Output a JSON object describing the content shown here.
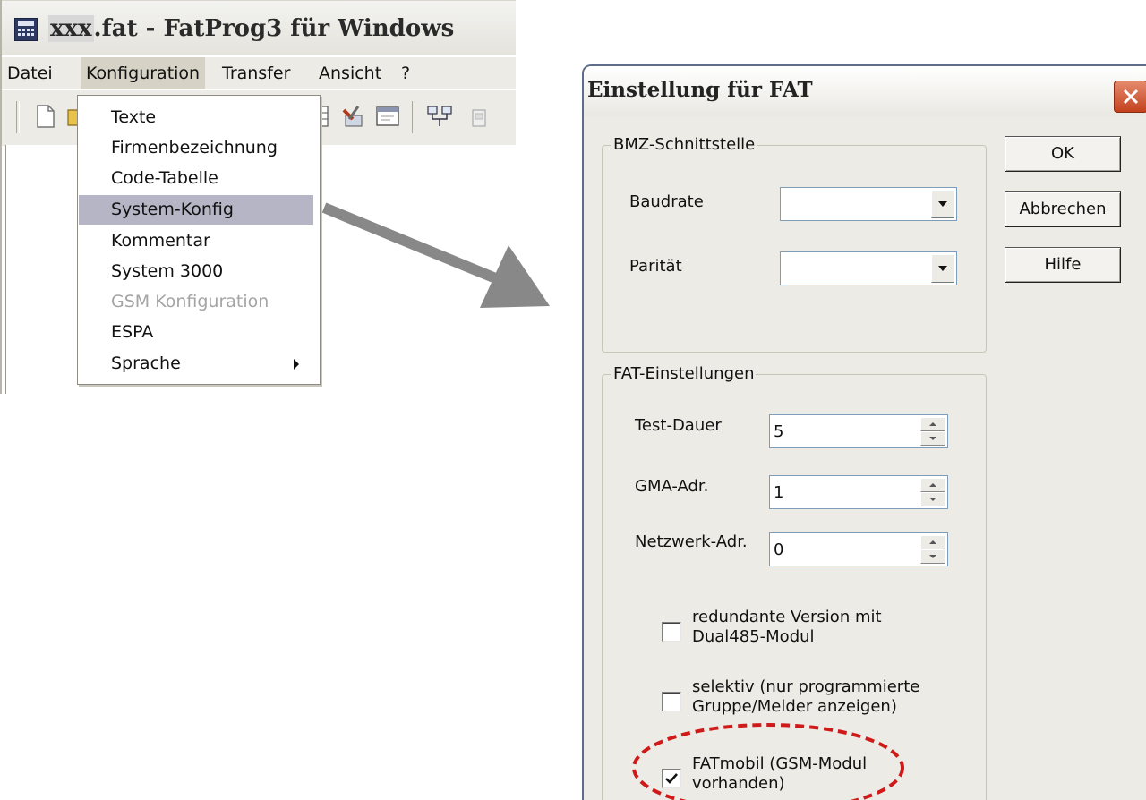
{
  "app": {
    "title_prefix": "xxx",
    "title": ".fat - FatProg3 für Windows",
    "menu": [
      "Datei",
      "Konfiguration",
      "Transfer",
      "Ansicht",
      "?"
    ],
    "open_menu": "Konfiguration"
  },
  "dropdown": {
    "items": [
      {
        "label": "Texte"
      },
      {
        "label": "Firmenbezeichnung"
      },
      {
        "label": "Code-Tabelle"
      },
      {
        "label": "System-Konfig",
        "state": "highlighted"
      },
      {
        "label": "Kommentar"
      },
      {
        "label": "System 3000"
      },
      {
        "label": "GSM Konfiguration",
        "state": "disabled"
      },
      {
        "label": "ESPA"
      },
      {
        "label": "Sprache",
        "submenu": true
      }
    ]
  },
  "dialog": {
    "title": "Einstellung für FAT",
    "bmz": {
      "legend": "BMZ-Schnittstelle",
      "baudrate_label": "Baudrate",
      "baudrate_value": "",
      "paritaet_label": "Parität",
      "paritaet_value": ""
    },
    "fat": {
      "legend": "FAT-Einstellungen",
      "test_dauer_label": "Test-Dauer",
      "test_dauer_value": "5",
      "gma_label": "GMA-Adr.",
      "gma_value": "1",
      "netzwerk_label": "Netzwerk-Adr.",
      "netzwerk_value": "0",
      "redundant_line1": "redundante Version mit",
      "redundant_line2": "Dual485-Modul",
      "redundant_checked": false,
      "selektiv_line1": "selektiv (nur programmierte",
      "selektiv_line2": "Gruppe/Melder anzeigen)",
      "selektiv_checked": false,
      "fatmobil_line1": "FATmobil (GSM-Modul",
      "fatmobil_line2": "vorhanden)",
      "fatmobil_checked": true
    },
    "buttons": {
      "ok": "OK",
      "abbrechen": "Abbrechen",
      "hilfe": "Hilfe"
    }
  },
  "colors": {
    "annotation_ellipse": "#d01a1a",
    "arrow": "#888888",
    "menu_highlight": "#b5b5c6"
  }
}
